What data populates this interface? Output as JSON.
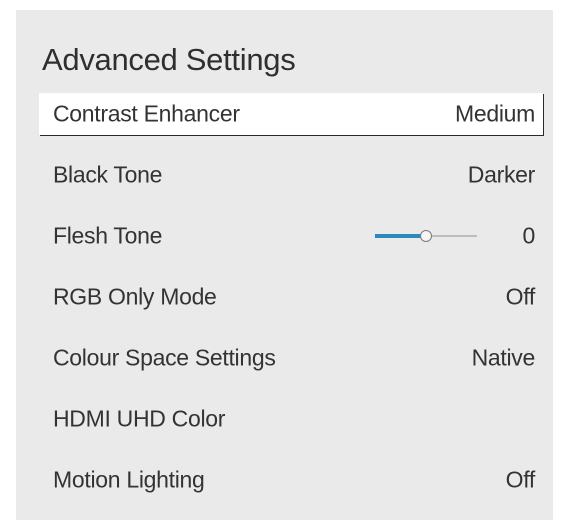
{
  "panel": {
    "title": "Advanced Settings",
    "items": [
      {
        "label": "Contrast Enhancer",
        "value": "Medium",
        "selected": true
      },
      {
        "label": "Black Tone",
        "value": "Darker"
      },
      {
        "label": "Flesh Tone",
        "value": "0",
        "slider": {
          "fraction": 0.5,
          "fill_color": "#2a8bb8"
        }
      },
      {
        "label": "RGB Only Mode",
        "value": "Off"
      },
      {
        "label": "Colour Space Settings",
        "value": "Native"
      },
      {
        "label": "HDMI UHD Color",
        "value": ""
      },
      {
        "label": "Motion Lighting",
        "value": "Off"
      }
    ]
  },
  "colors": {
    "panel_background": "#eaeaea",
    "selected_background": "#ffffff",
    "slider_accent": "#2a8bb8"
  }
}
